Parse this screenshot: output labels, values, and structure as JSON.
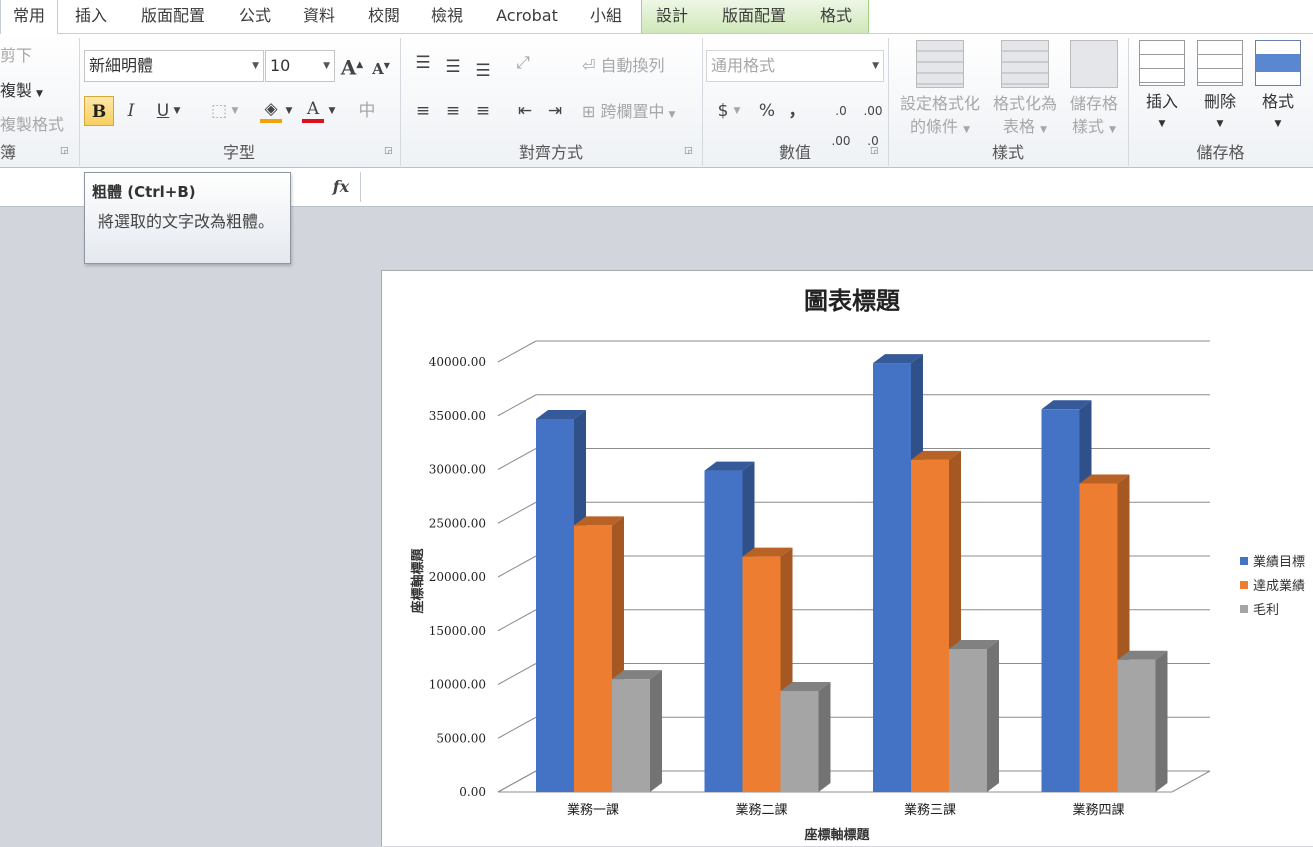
{
  "tabs": [
    "常用",
    "插入",
    "版面配置",
    "公式",
    "資料",
    "校閱",
    "檢視",
    "Acrobat",
    "小組",
    "設計",
    "版面配置",
    "格式"
  ],
  "clipboard": {
    "cut": "剪下",
    "copy": "複製",
    "format_painter": "複製格式",
    "group_label_partial": "簿"
  },
  "font_group": {
    "font_name": "新細明體",
    "font_size": "10",
    "bold": "B",
    "italic": "I",
    "underline": "U",
    "phonetic": "中",
    "label": "字型"
  },
  "alignment_group": {
    "wrap_text": "自動換列",
    "merge_center": "跨欄置中",
    "label": "對齊方式"
  },
  "number_group": {
    "format": "通用格式",
    "currency": "$",
    "percent": "%",
    "comma": "，",
    "inc_decimal": ".0→.00",
    "dec_decimal": ".00→.0",
    "label": "數值"
  },
  "styles_group": {
    "conditional_line1": "設定格式化",
    "conditional_line2": "的條件",
    "table_line1": "格式化為",
    "table_line2": "表格",
    "cell_line1": "儲存格",
    "cell_line2": "樣式",
    "label": "樣式"
  },
  "cells_group": {
    "insert": "插入",
    "delete": "刪除",
    "format": "格式",
    "label": "儲存格"
  },
  "formula_bar": {
    "fx": "fx"
  },
  "tooltip": {
    "title": "粗體 (Ctrl+B)",
    "body": "將選取的文字改為粗體。"
  },
  "colors": {
    "accent_fill": "#f0a30a",
    "accent_font": "#e0101a",
    "series1": "#4472c4",
    "series2": "#ed7d31",
    "series3": "#a5a5a5"
  },
  "chart_data": {
    "type": "bar",
    "title": "圖表標題",
    "xlabel": "座標軸標題",
    "ylabel": "座標軸標題",
    "categories": [
      "業務一課",
      "業務二課",
      "業務三課",
      "業務四課"
    ],
    "series": [
      {
        "name": "業績目標",
        "values": [
          34700,
          29900,
          39900,
          35600
        ]
      },
      {
        "name": "達成業績",
        "values": [
          24800,
          21900,
          30900,
          28700
        ]
      },
      {
        "name": "毛利",
        "values": [
          10500,
          9400,
          13300,
          12300
        ]
      }
    ],
    "ylim": [
      0,
      40000
    ],
    "yticks": [
      "0.00",
      "5000.00",
      "10000.00",
      "15000.00",
      "20000.00",
      "25000.00",
      "30000.00",
      "35000.00",
      "40000.00"
    ],
    "grid": true,
    "legend": "right",
    "style": "3d-clustered-column"
  }
}
